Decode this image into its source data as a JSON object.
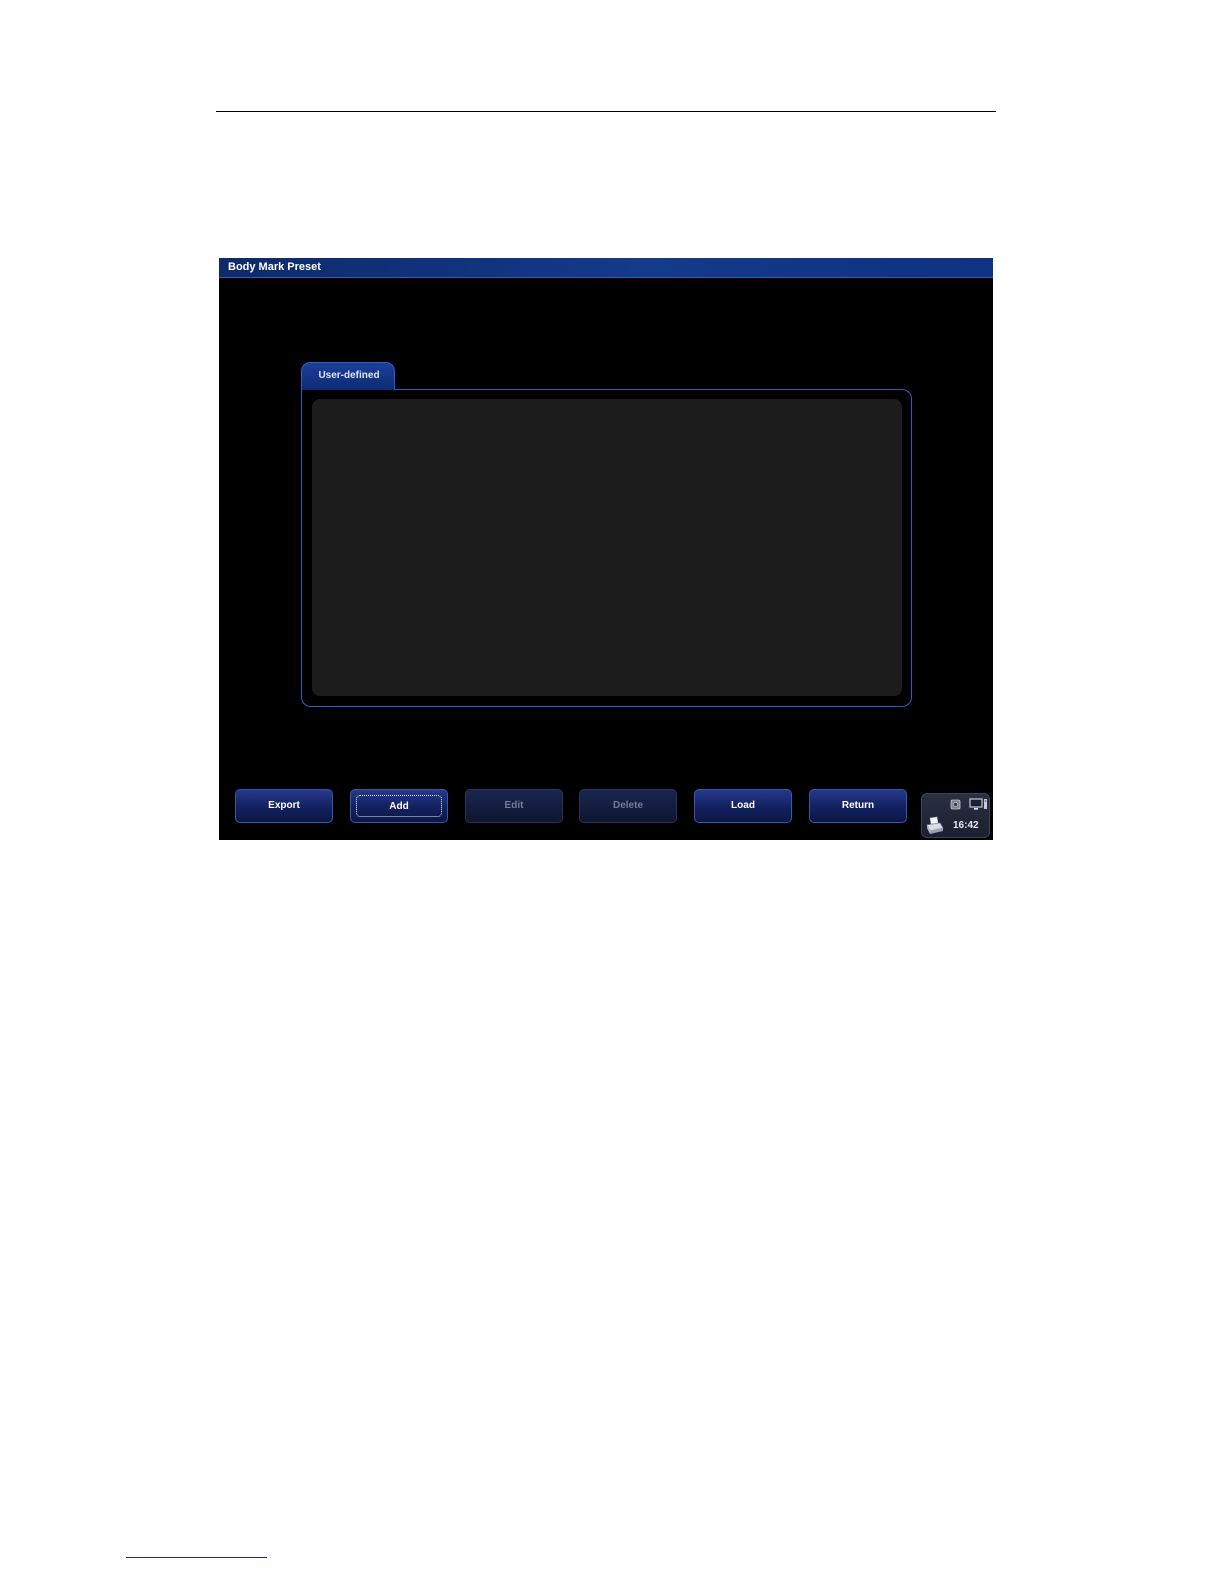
{
  "window": {
    "title": "Body Mark Preset"
  },
  "tabs": [
    {
      "label": "User-defined",
      "active": true
    }
  ],
  "buttons": {
    "export": {
      "label": "Export",
      "enabled": true
    },
    "add": {
      "label": "Add",
      "enabled": true,
      "focused": true
    },
    "edit": {
      "label": "Edit",
      "enabled": false
    },
    "delete": {
      "label": "Delete",
      "enabled": false
    },
    "load": {
      "label": "Load",
      "enabled": true
    },
    "return": {
      "label": "Return",
      "enabled": true
    }
  },
  "status": {
    "time": "16:42",
    "icons": [
      "disk-icon",
      "monitor-icon",
      "printer-icon"
    ]
  },
  "colors": {
    "title_bar": "#143a8a",
    "frame_border": "#2f5cc8",
    "panel_content": "#1c1c1c",
    "screen_background": "#000000"
  }
}
